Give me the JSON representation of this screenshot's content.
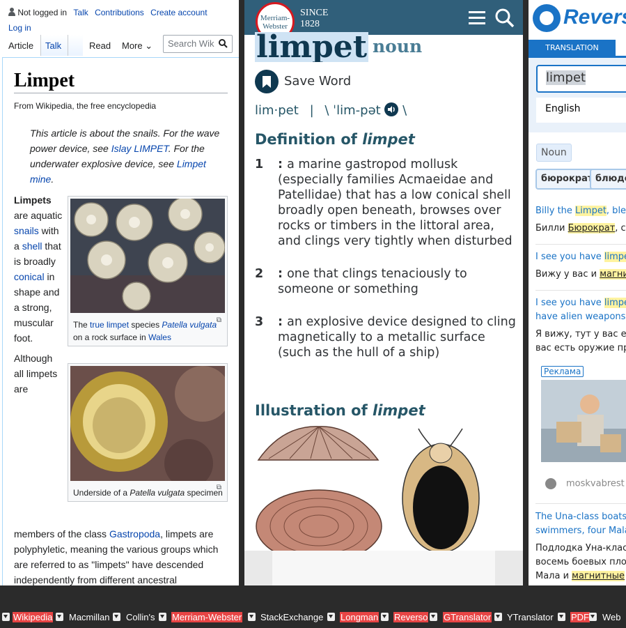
{
  "wikipedia": {
    "top_bar": {
      "not_logged_in": "Not logged in",
      "talk": "Talk",
      "contributions": "Contributions",
      "create_account": "Create account",
      "log_in": "Log in"
    },
    "tabs": {
      "article": "Article",
      "talk": "Talk",
      "read": "Read",
      "more": "More"
    },
    "search_placeholder": "Search Wik",
    "title": "Limpet",
    "from": "From Wikipedia, the free encyclopedia",
    "hatnote": {
      "t1": "This article is about the snails. For the wave power device, see ",
      "l1": "Islay LIMPET",
      "t2": ". For the underwater explosive device, see ",
      "l2": "Limpet mine",
      "t3": "."
    },
    "left_col": {
      "b": "Limpets",
      "t1": " are aquatic ",
      "l1": "snails",
      "t2": " with a ",
      "l2": "shell",
      "t3": " that is broadly ",
      "l3": "conical",
      "t4": " in shape and a strong, muscular foot.",
      "p2": "Although all limpets are"
    },
    "fig1_caption": {
      "t1": "The ",
      "l1": "true limpet",
      "t2": " species ",
      "l2": "Patella vulgata",
      "t3": " on a rock surface in ",
      "l3": "Wales"
    },
    "fig2_caption": {
      "t1": "Underside of a ",
      "i1": "Patella vulgata",
      "t2": " specimen"
    },
    "para": {
      "t1": "members of the class ",
      "l1": "Gastropoda",
      "t2": ", limpets are polyphyletic, meaning the various groups which are referred to as \"limpets\" have descended independently from different ancestral"
    }
  },
  "mw": {
    "logo_top": "Merriam-",
    "logo_bottom": "Webster",
    "since": "SINCE",
    "year": "1828",
    "word": "limpet",
    "pos": "noun",
    "save_word": "Save Word",
    "syllables": "lim·pet",
    "pron": "\\ ˈlim-pət",
    "pron_end": "\\",
    "def_heading": "Definition of ",
    "def_word": "limpet",
    "defs": [
      {
        "n": "1",
        "text": "a marine gastropod mollusk (especially families Acmaeidae and Patellidae) that has a low conical shell broadly open beneath, browses over rocks or timbers in the littoral area, and clings very tightly when disturbed"
      },
      {
        "n": "2",
        "text": "one that clings tenaciously to someone or something"
      },
      {
        "n": "3",
        "text": "an explosive device designed to cling magnetically to a metallic surface (such as the hull of a ship)"
      }
    ],
    "ill_heading": "Illustration of ",
    "ill_word": "limpet"
  },
  "reverso": {
    "brand": "Reverso",
    "tab": "TRANSLATION",
    "input_value": "limpet",
    "language": "English",
    "pos": "Noun",
    "chips": [
      "бюрократ",
      "блюдечко"
    ],
    "examples": [
      {
        "en_pre": "Billy the ",
        "en_mark": "Limpet",
        "en_post": ", bless",
        "ru_pre": "Билли ",
        "ru_mark": "Бюрократ",
        "ru_post": ", с"
      },
      {
        "en_pre": "I see you have ",
        "en_mark": "limpet",
        "en_post": "",
        "ru_pre": "Вижу у вас и ",
        "ru_mark": "магни",
        "ru_post": ""
      },
      {
        "en_pre": "I see you have ",
        "en_mark": "limpet",
        "en_post": "",
        "en2": "have alien weapons",
        "ru_pre": "Я вижу, тут у вас ест",
        "ru2": "вас есть оружие пр"
      },
      {
        "en_pre": "The Una-class boats",
        "en2": "swimmers, four Mala",
        "ru_pre": "Подлодка Уна-клас",
        "ru2": "восемь боевых пло",
        "ru3_pre": "Мала и ",
        "ru3_mark": "магнитные"
      }
    ],
    "ad_label": "Реклама",
    "ad_site": "moskvabrest"
  },
  "bottom_bar": [
    "Wikipedia",
    "Macmillan",
    "Collin's",
    "Merriam-Webster",
    "StackExchange",
    "Longman",
    "Reverso",
    "GTranslator",
    "YTranslator",
    "PDF",
    "Web"
  ],
  "colors": {
    "wiki_link": "#0645ad",
    "mw_header": "#305f7a",
    "reverso_blue": "#1a73c6",
    "bar_active": "#e84545"
  }
}
